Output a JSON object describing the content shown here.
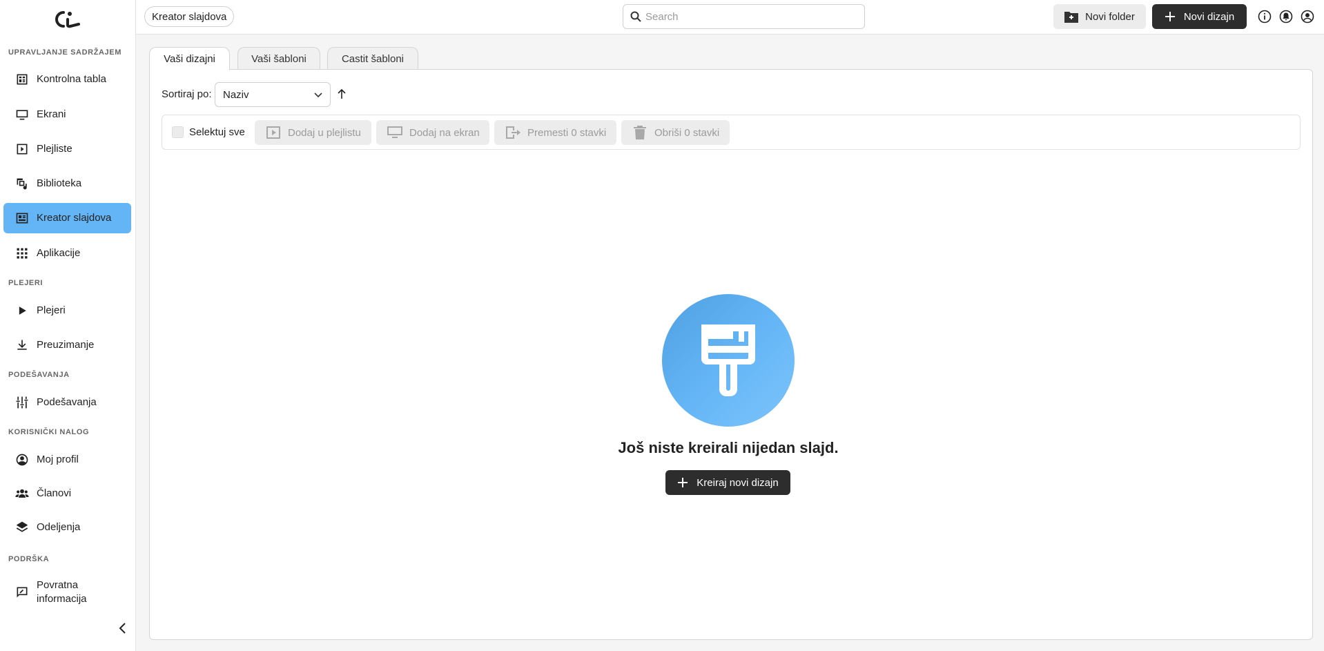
{
  "sidebar": {
    "sections": {
      "content": "UPRAVLJANJE SADRŽAJEM",
      "players": "PLEJERI",
      "settings": "PODEŠAVANJA",
      "account": "KORISNIČKI NALOG",
      "support": "PODRŠKA"
    },
    "items": {
      "dashboard": "Kontrolna tabla",
      "screens": "Ekrani",
      "playlists": "Plejliste",
      "library": "Biblioteka",
      "slide_creator": "Kreator slajdova",
      "apps": "Aplikacije",
      "players": "Plejeri",
      "downloads": "Preuzimanje",
      "settings": "Podešavanja",
      "profile": "Moj profil",
      "members": "Članovi",
      "departments": "Odeljenja",
      "feedback_line1": "Povratna",
      "feedback_line2": "informacija"
    },
    "active_item": "slide_creator",
    "active_color": "#64b5f6"
  },
  "topbar": {
    "breadcrumb": "Kreator slajdova",
    "search_placeholder": "Search",
    "new_folder": "Novi folder",
    "new_design": "Novi dizajn"
  },
  "tabs": {
    "your_designs": "Vaši dizajni",
    "your_templates": "Vaši šabloni",
    "castit_templates": "Castit šabloni",
    "active": "your_designs"
  },
  "sort": {
    "label": "Sortiraj po:",
    "value": "Naziv"
  },
  "toolbar": {
    "select_all": "Selektuj sve",
    "add_to_playlist": "Dodaj u plejlistu",
    "add_to_screen": "Dodaj na ekran",
    "move": "Premesti 0 stavki",
    "delete": "Obriši 0 stavki"
  },
  "empty_state": {
    "title": "Još niste kreirali nijedan slajd.",
    "button": "Kreiraj novi dizajn"
  },
  "colors": {
    "accent": "#64b5f6",
    "dark_button": "#2d2d2d"
  }
}
